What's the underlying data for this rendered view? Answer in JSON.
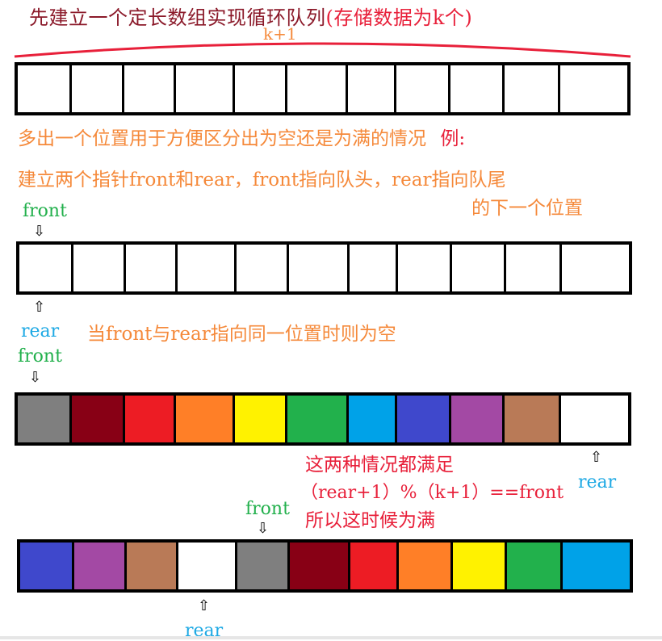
{
  "title": {
    "main": "先建立一个定长数组实现循环队列",
    "paren": "(存储数据为k个)"
  },
  "capacity_label": "k+1",
  "notes": {
    "extra_slot": "多出一个位置用于方便区分出为空还是为满的情况",
    "example": "例:",
    "pointers_line": "建立两个指针front和rear，front指向队头，rear指向队尾",
    "pointers_line2": "的下一个位置",
    "empty_condition": "当front与rear指向同一位置时则为空",
    "full_line1": "这两种情况都满足",
    "full_formula": "（rear+1）%（k+1）==front",
    "full_line2": "所以这时候为满"
  },
  "pointer_labels": {
    "front": "front",
    "rear": "rear"
  },
  "arrows": {
    "down": "⇩",
    "up": "⇧"
  },
  "colors": {
    "title": "#8b1a2a",
    "accent_red": "#e8203a",
    "note_orange": "#f5893a",
    "front_green": "#22b04c",
    "rear_blue": "#1ea9e4",
    "curve_red": "#e8203a"
  },
  "arrays": [
    {
      "name": "capacity-array",
      "cells": [
        "#ffffff",
        "#ffffff",
        "#ffffff",
        "#ffffff",
        "#ffffff",
        "#ffffff",
        "#ffffff",
        "#ffffff",
        "#ffffff",
        "#ffffff",
        "#ffffff"
      ]
    },
    {
      "name": "empty-queue-array",
      "front_index": 0,
      "rear_index": 0,
      "cells": [
        "#ffffff",
        "#ffffff",
        "#ffffff",
        "#ffffff",
        "#ffffff",
        "#ffffff",
        "#ffffff",
        "#ffffff",
        "#ffffff",
        "#ffffff",
        "#ffffff"
      ]
    },
    {
      "name": "full-queue-array-1",
      "front_index": 0,
      "rear_index": 10,
      "cells": [
        "#7f7f7f",
        "#880015",
        "#ed1c24",
        "#ff7f27",
        "#fff200",
        "#22b14c",
        "#00a2e8",
        "#3f48cc",
        "#a349a4",
        "#b97a57",
        "#ffffff"
      ]
    },
    {
      "name": "full-queue-array-2",
      "front_index": 4,
      "rear_index": 3,
      "cells": [
        "#3f48cc",
        "#a349a4",
        "#b97a57",
        "#ffffff",
        "#7f7f7f",
        "#880015",
        "#ed1c24",
        "#ff7f27",
        "#fff200",
        "#22b14c",
        "#00a2e8"
      ]
    }
  ]
}
